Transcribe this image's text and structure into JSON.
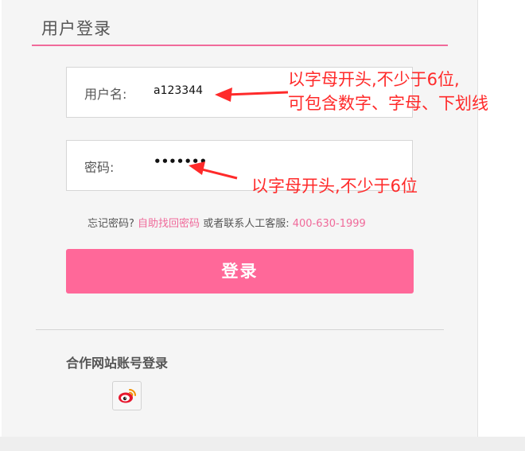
{
  "login": {
    "title": "用户登录",
    "username_label": "用户名:",
    "username_value": "a123344",
    "password_label": "密码:",
    "password_value": "•••••••",
    "forgot_prefix": "忘记密码?",
    "self_recover_link": "自助找回密码",
    "contact_text": " 或者联系人工客服:",
    "phone_link": "400-630-1999",
    "login_button": "登录",
    "partner_title": "合作网站账号登录"
  },
  "annotations": {
    "username_line1": "以字母开头,不少于6位,",
    "username_line2": "可包含数字、字母、下划线",
    "password_note": "以字母开头,不少于6位",
    "color": "#ff2a2a"
  },
  "colors": {
    "accent": "#f06a9a",
    "button": "#ff6899"
  },
  "icons": {
    "partner": "weibo-icon"
  }
}
